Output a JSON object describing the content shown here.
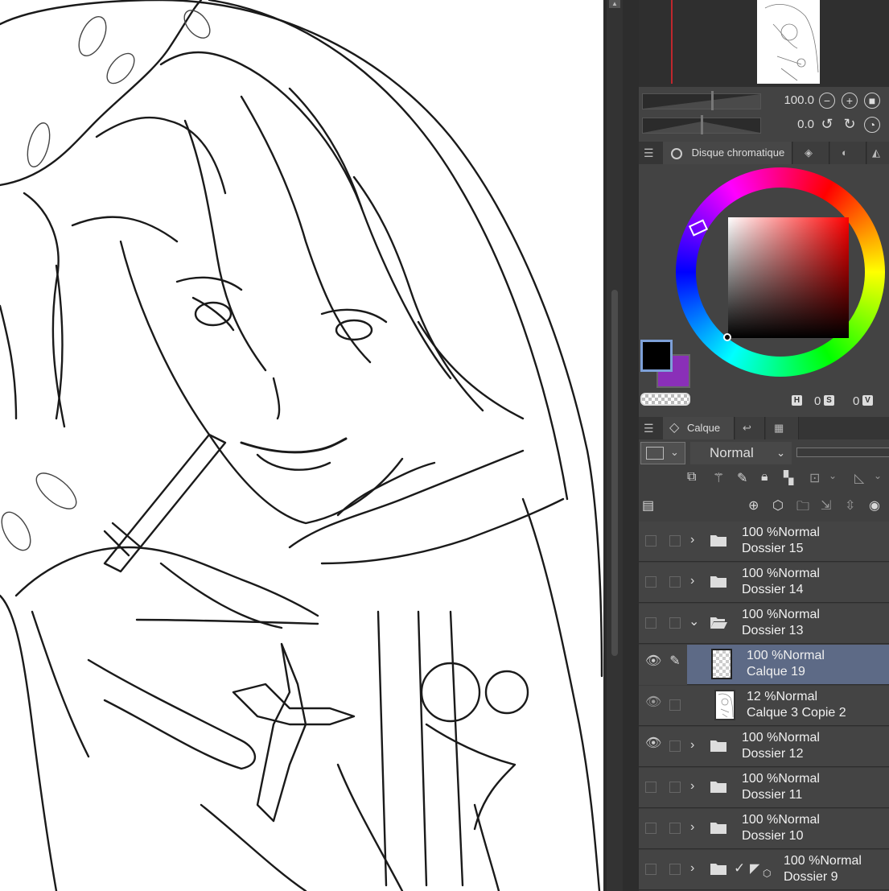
{
  "navigator": {
    "zoom_value": "100.0",
    "rotate_value": "0.0"
  },
  "color_panel": {
    "menu_icon": "menu-icon",
    "tab_label": "Disque chromatique",
    "main_color": "#000000",
    "sub_color": "#8a2fb8",
    "hue_label": "H",
    "hue_value": "0",
    "sat_label": "S",
    "sat_value": "0",
    "val_label": "V"
  },
  "layer_panel": {
    "tab_label": "Calque",
    "blend_mode": "Normal",
    "layers": [
      {
        "opacity_mode": "100 %Normal",
        "name": "Dossier 15",
        "type": "folder",
        "expanded": false,
        "visible": false,
        "selected": false
      },
      {
        "opacity_mode": "100 %Normal",
        "name": "Dossier 14",
        "type": "folder",
        "expanded": false,
        "visible": false,
        "selected": false
      },
      {
        "opacity_mode": "100 %Normal",
        "name": "Dossier 13",
        "type": "folder",
        "expanded": true,
        "visible": false,
        "selected": false
      },
      {
        "opacity_mode": "100 %Normal",
        "name": "Calque 19",
        "type": "raster",
        "expanded": false,
        "visible": true,
        "selected": true
      },
      {
        "opacity_mode": "12 %Normal",
        "name": "Calque 3 Copie 2",
        "type": "raster",
        "expanded": false,
        "visible": true,
        "selected": false
      },
      {
        "opacity_mode": "100 %Normal",
        "name": "Dossier 12",
        "type": "folder",
        "expanded": false,
        "visible": true,
        "selected": false
      },
      {
        "opacity_mode": "100 %Normal",
        "name": "Dossier 11",
        "type": "folder",
        "expanded": false,
        "visible": false,
        "selected": false
      },
      {
        "opacity_mode": "100 %Normal",
        "name": "Dossier 10",
        "type": "folder",
        "expanded": false,
        "visible": false,
        "selected": false
      },
      {
        "opacity_mode": "100 %Normal",
        "name": "Dossier 9",
        "type": "folder",
        "expanded": false,
        "visible": false,
        "selected": false
      }
    ]
  }
}
